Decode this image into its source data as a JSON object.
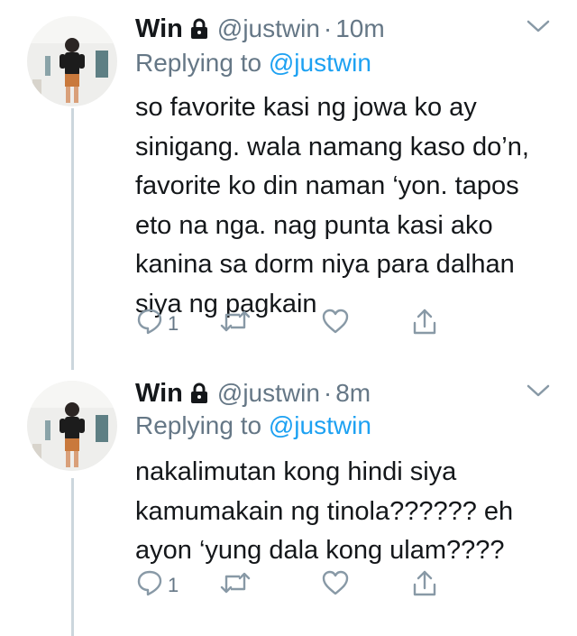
{
  "tweets": [
    {
      "name": "Win",
      "handle": "@justwin",
      "separator": "·",
      "time": "10m",
      "reply_prefix": "Replying to",
      "reply_handle": "@justwin",
      "lines": [
        "so favorite kasi ng jowa ko ay",
        "sinigang. wala namang kaso do’n,",
        "favorite ko din naman ‘yon. tapos",
        "eto na nga. nag punta kasi ako",
        "kanina sa dorm niya para dalhan",
        "siya ng pagkain"
      ],
      "reply_count": "1"
    },
    {
      "name": "Win",
      "handle": "@justwin",
      "separator": "·",
      "time": "8m",
      "reply_prefix": "Replying to",
      "reply_handle": "@justwin",
      "lines": [
        "nakalimutan kong hindi siya",
        "kamumakain ng tinola?????? eh",
        "ayon ‘yung dala kong ulam????"
      ],
      "reply_count": "1"
    }
  ],
  "colors": {
    "text": "#14171a",
    "secondary": "#657786",
    "link": "#1da1f2",
    "thread_line": "#ccd6dd",
    "icon": "#8899a6"
  }
}
